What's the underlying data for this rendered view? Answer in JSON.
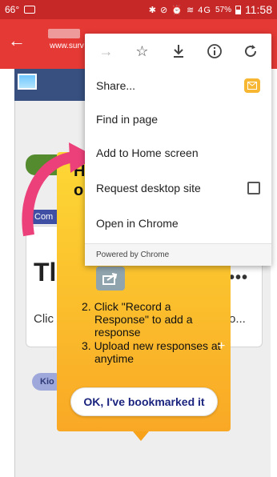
{
  "status_bar": {
    "temperature": "66°",
    "battery_percent": "57%",
    "time": "11:58",
    "signal_icons": "✱ ⊘ ⏰ ≋ 4G"
  },
  "toolbar": {
    "url": "www.surv"
  },
  "chrome_menu": {
    "top_icons": [
      "forward-icon",
      "star-icon",
      "download-icon",
      "info-icon",
      "refresh-icon"
    ],
    "items": [
      {
        "label": "Share..."
      },
      {
        "label": "Find in page"
      },
      {
        "label": "Add to Home screen"
      },
      {
        "label": "Request desktop site"
      },
      {
        "label": "Open in Chrome"
      }
    ],
    "footer": "Powered by Chrome"
  },
  "tooltip": {
    "heading_line1": "H",
    "heading_line2": "o",
    "steps": [
      "2. Click \"Record a Response\" to add a response",
      "3. Upload new responses at anytime"
    ],
    "ok_button": "OK, I've bookmarked it"
  },
  "page": {
    "comp_tag": "Com",
    "card_title": "Tl",
    "card_text_left": "Clic",
    "card_text_right": "o...",
    "card_ellipsis": "•••",
    "kio_tag": "Kio"
  },
  "colors": {
    "status_bar": "#c62828",
    "toolbar": "#e53935",
    "tooltip_top": "#fdd835",
    "tooltip_bottom": "#f9a825",
    "pink_arrow": "#ec407a",
    "ok_text": "#1a237e"
  }
}
